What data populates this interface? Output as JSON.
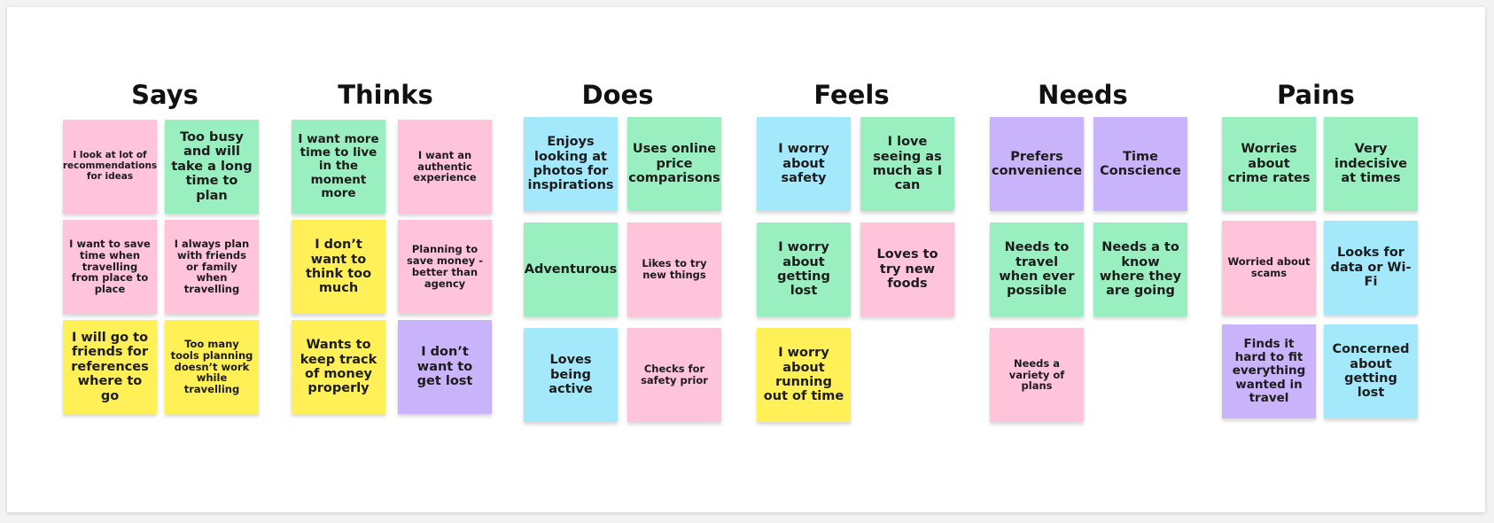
{
  "columns": [
    {
      "title": "Says",
      "notes": [
        {
          "text": "I look at lot of recommendations for ideas",
          "color": "pink"
        },
        {
          "text": "Too busy and will take a long time to plan",
          "color": "green"
        },
        {
          "text": "I want to save time when travelling from place to place",
          "color": "pink"
        },
        {
          "text": "I always plan with friends or family when travelling",
          "color": "pink"
        },
        {
          "text": "I will go to friends for references where to go",
          "color": "yellow"
        },
        {
          "text": "Too many tools planning doesn’t work while travelling",
          "color": "yellow"
        }
      ]
    },
    {
      "title": "Thinks",
      "notes": [
        {
          "text": "I want more time to live in the moment more",
          "color": "green"
        },
        {
          "text": "I want an authentic experience",
          "color": "pink"
        },
        {
          "text": "I don’t want to think too much",
          "color": "yellow"
        },
        {
          "text": "Planning to save money - better than agency",
          "color": "pink"
        },
        {
          "text": "Wants to keep track of money properly",
          "color": "yellow"
        },
        {
          "text": "I don’t want to get lost",
          "color": "purple"
        }
      ]
    },
    {
      "title": "Does",
      "notes": [
        {
          "text": "Enjoys looking at photos for inspirations",
          "color": "blue"
        },
        {
          "text": "Uses online price comparisons",
          "color": "green"
        },
        {
          "text": "Adventurous",
          "color": "green"
        },
        {
          "text": "Likes to try new things",
          "color": "pink"
        },
        {
          "text": "Loves being active",
          "color": "blue"
        },
        {
          "text": "Checks for safety prior",
          "color": "pink"
        }
      ]
    },
    {
      "title": "Feels",
      "notes": [
        {
          "text": "I worry about safety",
          "color": "blue"
        },
        {
          "text": "I love seeing as much as I can",
          "color": "green"
        },
        {
          "text": "I worry about getting lost",
          "color": "green"
        },
        {
          "text": "Loves to try new foods",
          "color": "pink"
        },
        {
          "text": "I worry about running out of time",
          "color": "yellow"
        }
      ]
    },
    {
      "title": "Needs",
      "notes": [
        {
          "text": "Prefers convenience",
          "color": "purple"
        },
        {
          "text": "Time Conscience",
          "color": "purple"
        },
        {
          "text": "Needs to travel when ever possible",
          "color": "green"
        },
        {
          "text": "Needs a to know where they are going",
          "color": "green"
        },
        {
          "text": "Needs a variety of plans",
          "color": "pink"
        }
      ]
    },
    {
      "title": "Pains",
      "notes": [
        {
          "text": "Worries about crime rates",
          "color": "green"
        },
        {
          "text": "Very indecisive at times",
          "color": "green"
        },
        {
          "text": "Worried about scams",
          "color": "pink"
        },
        {
          "text": "Looks for data or Wi-Fi",
          "color": "blue"
        },
        {
          "text": "Finds it hard to fit everything wanted in travel",
          "color": "purple"
        },
        {
          "text": "Concerned about getting lost",
          "color": "blue"
        }
      ]
    }
  ]
}
